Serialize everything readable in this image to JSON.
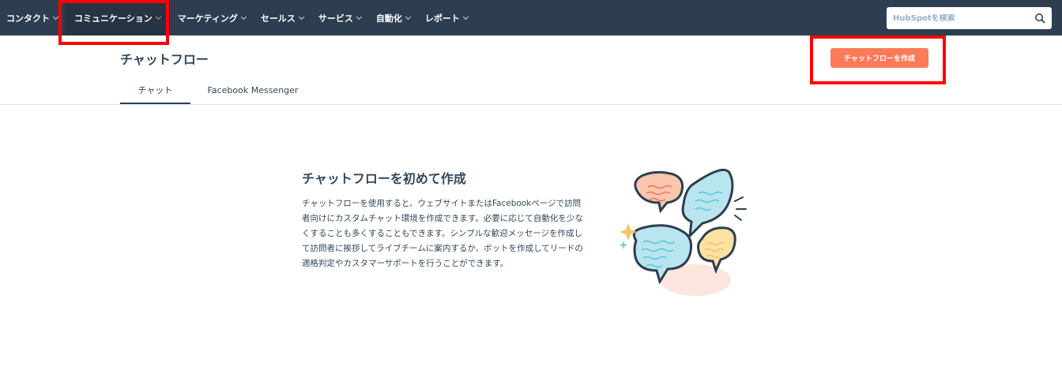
{
  "nav": {
    "items": [
      {
        "label": "コンタクト"
      },
      {
        "label": "コミュニケーション"
      },
      {
        "label": "マーケティング"
      },
      {
        "label": "セールス"
      },
      {
        "label": "サービス"
      },
      {
        "label": "自動化"
      },
      {
        "label": "レポート"
      }
    ],
    "active_index": 1,
    "search_placeholder": "HubSpotを検索"
  },
  "header": {
    "title": "チャットフロー",
    "create_button_label": "チャットフローを作成"
  },
  "tabs": [
    {
      "label": "チャット",
      "active": true
    },
    {
      "label": "Facebook Messenger",
      "active": false
    }
  ],
  "empty_state": {
    "heading": "チャットフローを初めて作成",
    "body": "チャットフローを使用すると、ウェブサイトまたはFacebookページで訪問者向けにカスタムチャット環境を作成できます。必要に応じて自動化を少なくすることも多くすることもできます。シンプルな歓迎メッセージを作成して訪問者に挨拶してライブチームに案内するか、ボットを作成してリードの適格判定やカスタマーサポートを行うことができます。"
  },
  "colors": {
    "nav_bg": "#2d3e50",
    "accent": "#ff7a59",
    "text": "#33475b",
    "highlight": "#ff0000"
  },
  "icons": [
    "chevron-down-icon",
    "search-icon",
    "chat-bubbles-illustration"
  ]
}
